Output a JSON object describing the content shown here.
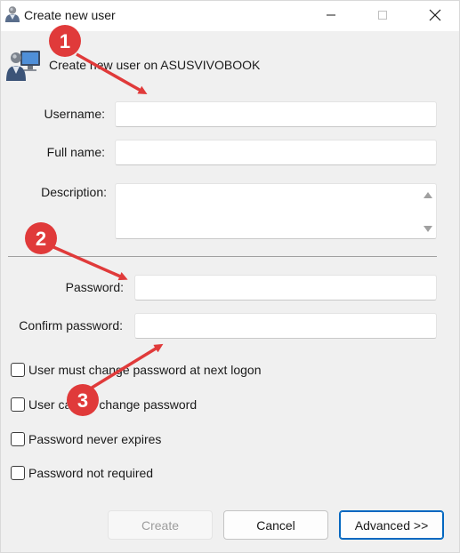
{
  "window": {
    "title": "Create new user"
  },
  "header": {
    "text": "Create new user on ASUSVIVOBOOK"
  },
  "form": {
    "username_label": "Username:",
    "username_value": "",
    "fullname_label": "Full name:",
    "fullname_value": "",
    "description_label": "Description:",
    "description_value": "",
    "password_label": "Password:",
    "password_value": "",
    "confirm_label": "Confirm password:",
    "confirm_value": ""
  },
  "options": [
    {
      "label": "User must change password at next logon",
      "checked": false
    },
    {
      "label": "User cannot change password",
      "checked": false
    },
    {
      "label": "Password never expires",
      "checked": false
    },
    {
      "label": "Password not required",
      "checked": false
    }
  ],
  "buttons": {
    "create": "Create",
    "cancel": "Cancel",
    "advanced": "Advanced >>"
  },
  "annotations": {
    "marker_1": "1",
    "marker_2": "2",
    "marker_3": "3",
    "marker_color": "#e03a3a"
  },
  "colors": {
    "accent": "#0067c0",
    "disabled_text": "#9d9d9d"
  }
}
